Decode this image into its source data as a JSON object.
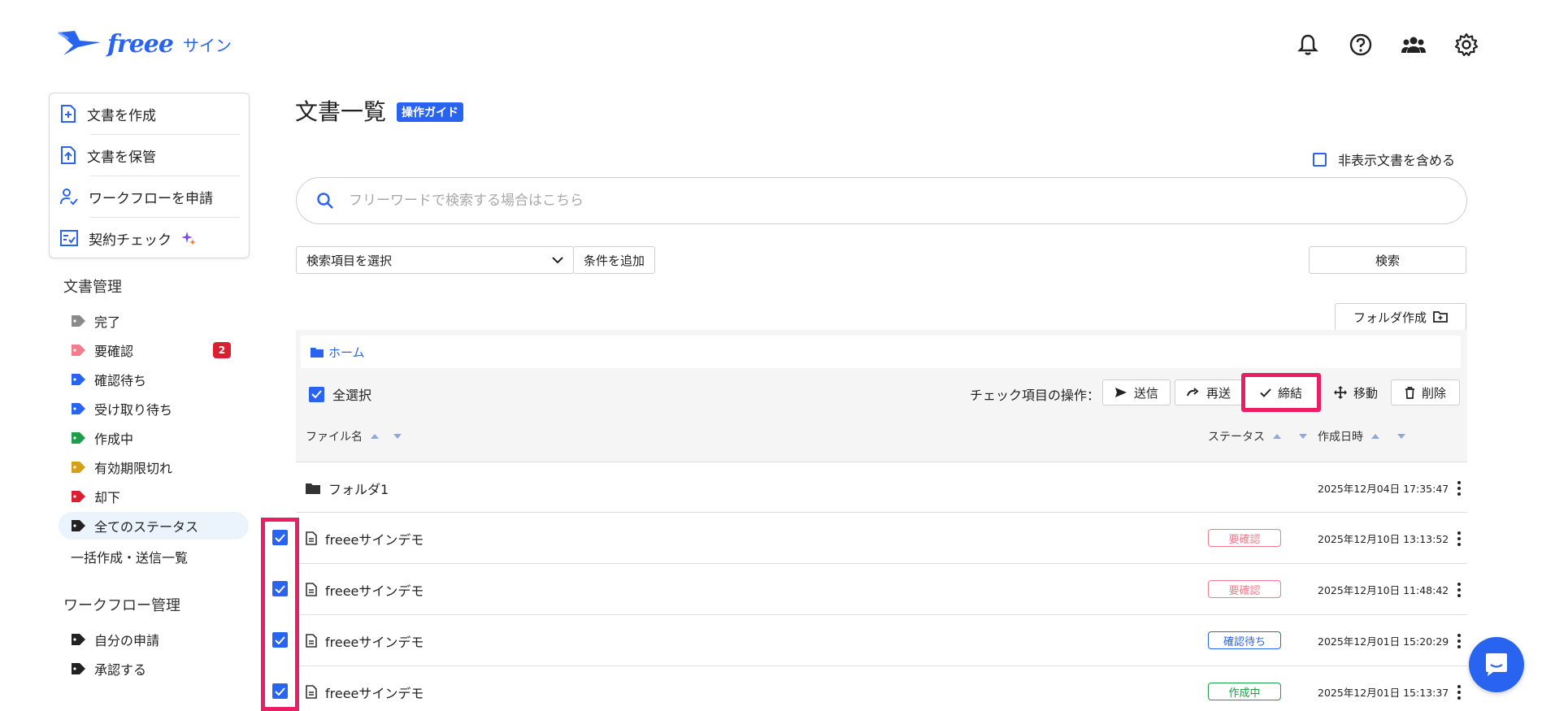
{
  "app": {
    "logo_text": "freee",
    "logo_sub": "サイン"
  },
  "colors": {
    "primary": "#2864f0",
    "highlight": "#e91e63",
    "danger": "#dc1e32"
  },
  "header_icons": [
    "bell-icon",
    "help-icon",
    "team-icon",
    "gear-icon"
  ],
  "quick_actions": [
    {
      "label": "文書を作成",
      "icon": "document-plus-icon"
    },
    {
      "label": "文書を保管",
      "icon": "document-upload-icon"
    },
    {
      "label": "ワークフローを申請",
      "icon": "user-check-icon"
    },
    {
      "label": "契約チェック",
      "icon": "checklist-icon"
    }
  ],
  "doc_mgmt": {
    "title": "文書管理",
    "statuses": [
      {
        "label": "完了",
        "color": "#8a8a8a"
      },
      {
        "label": "要確認",
        "color": "#f07c8c",
        "badge": "2"
      },
      {
        "label": "確認待ち",
        "color": "#2864f0"
      },
      {
        "label": "受け取り待ち",
        "color": "#2864f0"
      },
      {
        "label": "作成中",
        "color": "#1e9e4a"
      },
      {
        "label": "有効期限切れ",
        "color": "#d4a017"
      },
      {
        "label": "却下",
        "color": "#dc1e32"
      },
      {
        "label": "全てのステータス",
        "color": "#222222"
      }
    ],
    "bulk_link": "一括作成・送信一覧"
  },
  "workflow_mgmt": {
    "title": "ワークフロー管理",
    "items": [
      "自分の申請",
      "承認する"
    ]
  },
  "main": {
    "title": "文書一覧",
    "guide_badge": "操作ガイド",
    "include_hidden_label": "非表示文書を含める",
    "search_placeholder": "フリーワードで検索する場合はこちら",
    "select_label": "検索項目を選択",
    "add_condition": "条件を追加",
    "search_button": "検索",
    "create_folder": "フォルダ作成",
    "breadcrumb_home": "ホーム",
    "select_all": "全選択",
    "bulk_ops_label": "チェック項目の操作：",
    "bulk_ops": {
      "send": "送信",
      "resend": "再送",
      "conclude": "締結",
      "move": "移動",
      "delete": "削除"
    },
    "columns": {
      "file_name": "ファイル名",
      "status": "ステータス",
      "created": "作成日時"
    },
    "rows": [
      {
        "type": "folder",
        "name": "フォルダ1",
        "status": "",
        "date": "2025年12月04日 17:35:47",
        "checked": false
      },
      {
        "type": "file",
        "name": "freeeサインデモ",
        "status": "要確認",
        "status_color": "#f07c8c",
        "date": "2025年12月10日 13:13:52",
        "checked": true
      },
      {
        "type": "file",
        "name": "freeeサインデモ",
        "status": "要確認",
        "status_color": "#f07c8c",
        "date": "2025年12月10日 11:48:42",
        "checked": true
      },
      {
        "type": "file",
        "name": "freeeサインデモ",
        "status": "確認待ち",
        "status_color": "#2864f0",
        "date": "2025年12月01日 15:20:29",
        "checked": true
      },
      {
        "type": "file",
        "name": "freeeサインデモ",
        "status": "作成中",
        "status_color": "#1e9e4a",
        "date": "2025年12月01日 15:13:37",
        "checked": true
      }
    ]
  }
}
